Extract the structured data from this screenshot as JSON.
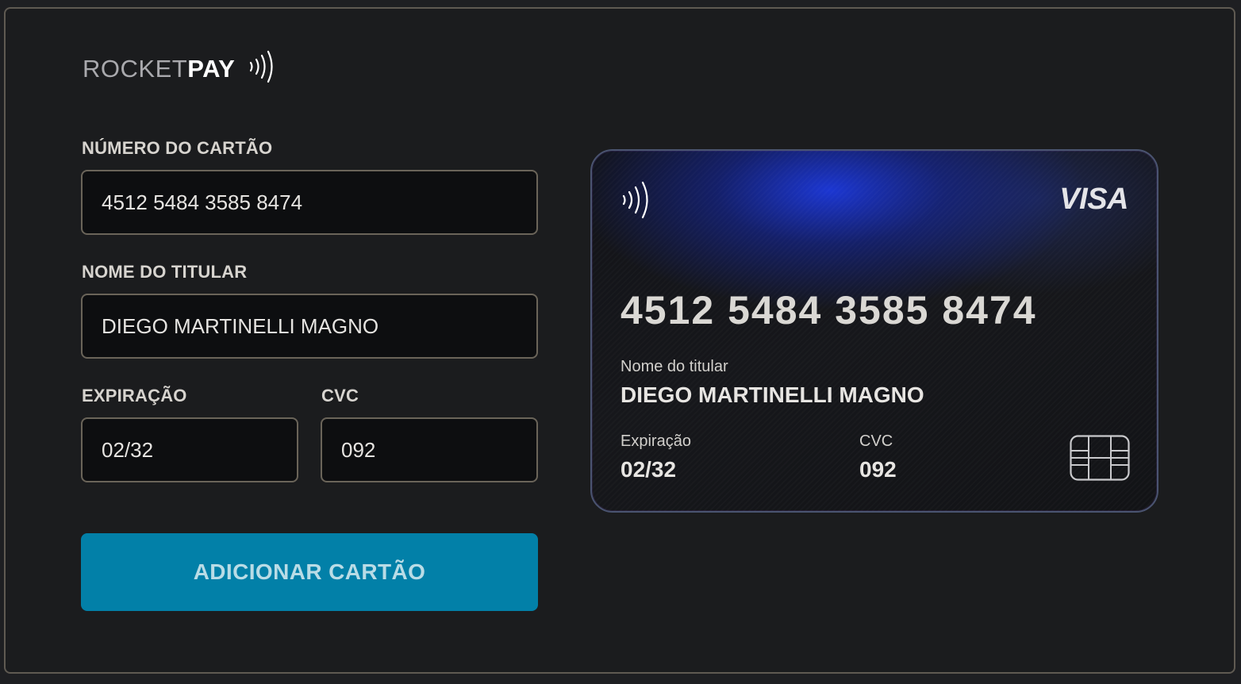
{
  "brand": {
    "name_light": "ROCKET",
    "name_bold": "PAY",
    "icon": "contactless-icon"
  },
  "form": {
    "card_number": {
      "label": "NÚMERO DO CARTÃO",
      "value": "4512 5484 3585 8474"
    },
    "holder_name": {
      "label": "NOME DO TITULAR",
      "value": "DIEGO MARTINELLI MAGNO"
    },
    "expiration": {
      "label": "EXPIRAÇÃO",
      "value": "02/32"
    },
    "cvc": {
      "label": "CVC",
      "value": "092"
    },
    "submit_label": "ADICIONAR CARTÃO"
  },
  "card_preview": {
    "network": "VISA",
    "number": "4512 5484 3585 8474",
    "holder_label": "Nome do titular",
    "holder_value": "DIEGO MARTINELLI MAGNO",
    "expiration_label": "Expiração",
    "expiration_value": "02/32",
    "cvc_label": "CVC",
    "cvc_value": "092",
    "icons": [
      "contactless-icon",
      "chip-icon"
    ]
  },
  "colors": {
    "background": "#1b1c1e",
    "accent_button": "#0280a8",
    "card_glow": "#1c38dc"
  }
}
